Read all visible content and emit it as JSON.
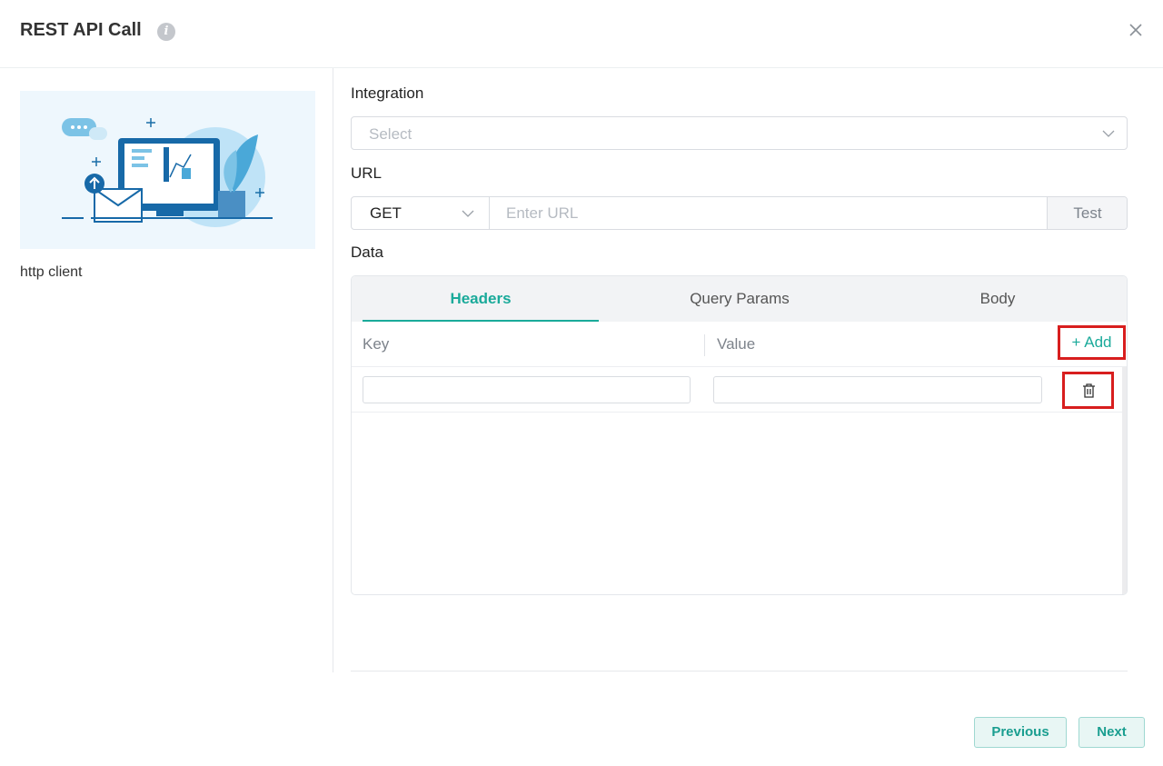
{
  "dialog": {
    "title": "REST API Call",
    "info_icon": "info-icon",
    "close_icon": "close-icon"
  },
  "sidebar": {
    "app_name": "http client"
  },
  "form": {
    "integration": {
      "label": "Integration",
      "placeholder": "Select"
    },
    "url": {
      "label": "URL",
      "method": "GET",
      "placeholder": "Enter URL",
      "test_label": "Test"
    },
    "data": {
      "label": "Data",
      "tabs": [
        {
          "label": "Headers",
          "active": true
        },
        {
          "label": "Query Params",
          "active": false
        },
        {
          "label": "Body",
          "active": false
        }
      ],
      "key_header": "Key",
      "value_header": "Value",
      "add_label": "+ Add",
      "rows": [
        {
          "key": "",
          "value": ""
        }
      ]
    }
  },
  "footer": {
    "previous_label": "Previous",
    "next_label": "Next"
  },
  "colors": {
    "accent": "#1aaa9a",
    "highlight_box": "#d81e1e"
  }
}
